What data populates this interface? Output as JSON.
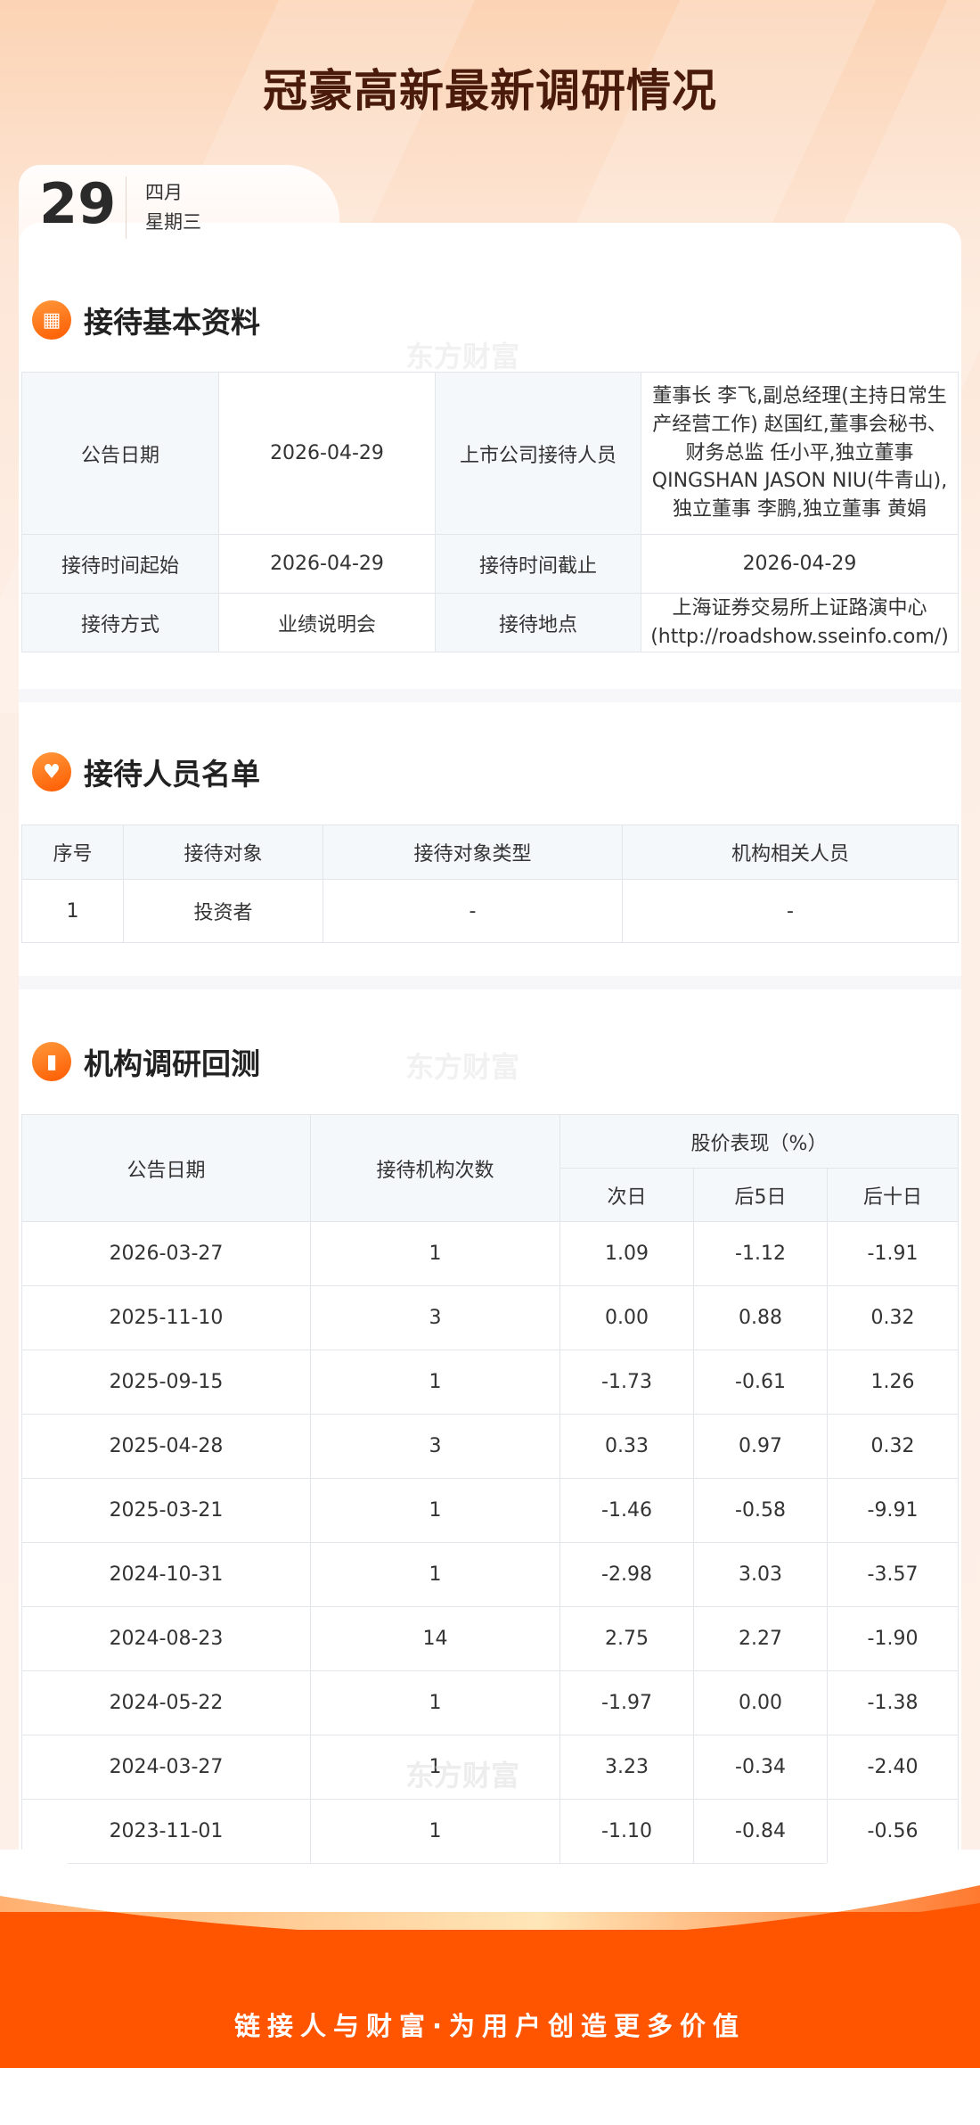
{
  "title": "冠豪高新最新调研情况",
  "date": {
    "day": "29",
    "month": "四月",
    "weekday": "星期三"
  },
  "watermark": "东方财富",
  "section1": {
    "title": "接待基本资料",
    "rows": [
      [
        "公告日期",
        "2026-04-29",
        "上市公司接待人员",
        "董事长 李飞,副总经理(主持日常生产经营工作) 赵国红,董事会秘书、财务总监 任小平,独立董事 QINGSHAN JASON NIU(牛青山),独立董事 李鹏,独立董事 黄娟"
      ],
      [
        "接待时间起始",
        "2026-04-29",
        "接待时间截止",
        "2026-04-29"
      ],
      [
        "接待方式",
        "业绩说明会",
        "接待地点",
        "上海证券交易所上证路演中心(http://roadshow.sseinfo.com/)"
      ]
    ]
  },
  "section2": {
    "title": "接待人员名单",
    "headers": [
      "序号",
      "接待对象",
      "接待对象类型",
      "机构相关人员"
    ],
    "rows": [
      [
        "1",
        "投资者",
        "-",
        "-"
      ]
    ]
  },
  "section3": {
    "title": "机构调研回测",
    "headers": {
      "date": "公告日期",
      "count": "接待机构次数",
      "perf": "股价表现（%）",
      "d1": "次日",
      "d5": "后5日",
      "d10": "后十日"
    },
    "rows": [
      [
        "2026-03-27",
        "1",
        "1.09",
        "-1.12",
        "-1.91"
      ],
      [
        "2025-11-10",
        "3",
        "0.00",
        "0.88",
        "0.32"
      ],
      [
        "2025-09-15",
        "1",
        "-1.73",
        "-0.61",
        "1.26"
      ],
      [
        "2025-04-28",
        "3",
        "0.33",
        "0.97",
        "0.32"
      ],
      [
        "2025-03-21",
        "1",
        "-1.46",
        "-0.58",
        "-9.91"
      ],
      [
        "2024-10-31",
        "1",
        "-2.98",
        "3.03",
        "-3.57"
      ],
      [
        "2024-08-23",
        "14",
        "2.75",
        "2.27",
        "-1.90"
      ],
      [
        "2024-05-22",
        "1",
        "-1.97",
        "0.00",
        "-1.38"
      ],
      [
        "2024-03-27",
        "1",
        "3.23",
        "-0.34",
        "-2.40"
      ],
      [
        "2023-11-01",
        "1",
        "-1.10",
        "-0.84",
        "-0.56"
      ]
    ]
  },
  "footer": {
    "slogan": "链接人与财富·为用户创造更多价值"
  }
}
